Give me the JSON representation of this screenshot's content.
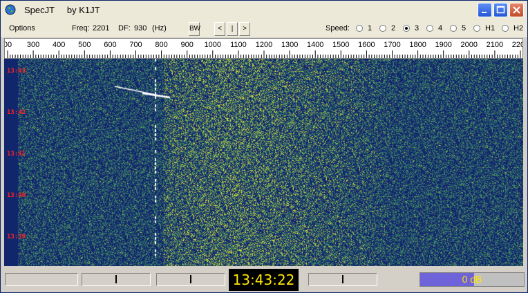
{
  "window": {
    "title": "SpecJT     by K1JT",
    "icon": "globe-icon",
    "controls": [
      "minimize-icon",
      "maximize-icon",
      "close-icon"
    ]
  },
  "toolbar": {
    "options_label": "Options",
    "freq_label": "Freq:",
    "freq_value": "2201",
    "df_label": "DF:",
    "df_value": "930",
    "df_unit": "(Hz)",
    "bw_label": "BW",
    "prev_label": "<",
    "center_label": "|",
    "next_label": ">",
    "speed_label": "Speed:",
    "speed_options": [
      "1",
      "2",
      "3",
      "4",
      "5",
      "H1",
      "H2"
    ],
    "speed_selected": "3"
  },
  "scale": {
    "labels": [
      "00",
      "300",
      "400",
      "500",
      "600",
      "700",
      "800",
      "900",
      "1000",
      "1100",
      "1200",
      "1300",
      "1400",
      "1500",
      "1600",
      "1700",
      "1800",
      "1900",
      "2000",
      "2100",
      "2200"
    ]
  },
  "waterfall": {
    "time_labels": [
      "13:43",
      "13:42",
      "13:41",
      "13:40",
      "13:39"
    ],
    "label_color": "#ff2020",
    "trace_frequency_hz": 800
  },
  "status": {
    "clock": "13:43:22",
    "db_level": "0 dB",
    "db_fill_fraction": 0.52
  },
  "colors": {
    "waterfall_bg": "#1b2f7a",
    "clock_text": "#ffe600",
    "db_fill": "#6e63d8"
  }
}
